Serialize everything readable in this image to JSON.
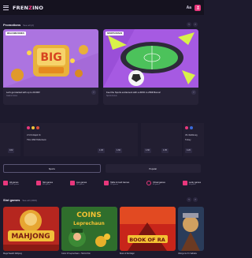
{
  "header": {
    "logo_main": "FREN",
    "logo_accent": "Z",
    "logo_end": "INO",
    "lang_label": "Aa"
  },
  "promotions": {
    "title": "Promotions",
    "count": "See all (2)",
    "cards": [
      {
        "badge": "WELCOME BONUS",
        "text": "Let's get started with up to 20.000!",
        "sub": "Casino bonus"
      },
      {
        "badge": "SPORTS BONUS",
        "text": "Feel the Sports excitement with a 200% to 250€ Bonus!",
        "sub": "Sports bonus"
      }
    ]
  },
  "matches": [
    {
      "team1": "LT-CS Rapid Ot",
      "team2": "TSG 1899 Hoffenheim",
      "o1": "1.93",
      "o2": "1.60"
    },
    {
      "team1": "",
      "team2": "",
      "o1": "1.60",
      "o2": "1.05"
    },
    {
      "team1": "VfL Wolfsburg",
      "team2": "Turkey",
      "o1": "4.20",
      "o2": ""
    }
  ],
  "toggles": {
    "sport": "Sports",
    "casino": "Popular"
  },
  "categories": [
    {
      "label": "All games",
      "sub": "1000+ games"
    },
    {
      "label": "Slot games",
      "sub": "800 games"
    },
    {
      "label": "Live games",
      "sub": "200 games"
    },
    {
      "label": "Table & Card Games",
      "sub": "150 games"
    },
    {
      "label": "Virtual games",
      "sub": "80 games"
    },
    {
      "label": "Lucky games",
      "sub": "60 games"
    }
  ],
  "slots": {
    "title": "Slot games",
    "count": "See all (1000)",
    "games": [
      {
        "name": "Mega Wealth Mahjong"
      },
      {
        "name": "Coins Of Leprechaun - Hold & Win"
      },
      {
        "name": "Book of Ra Magic"
      },
      {
        "name": "Vikings Go To Valhalla"
      }
    ]
  },
  "colors": {
    "accent": "#e8377c",
    "bg": "#1d1a2d",
    "card": "#262236"
  }
}
